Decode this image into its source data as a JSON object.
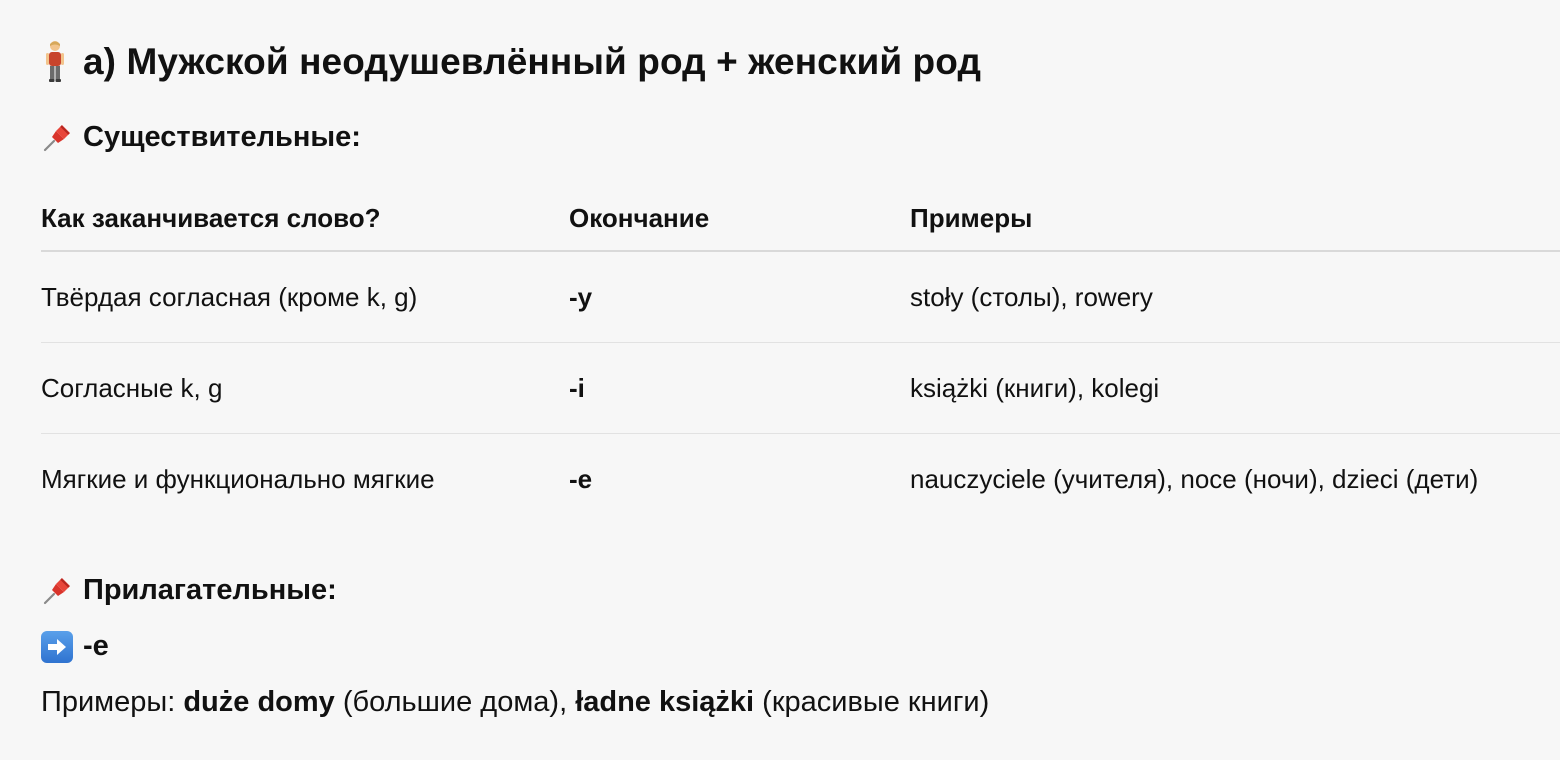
{
  "heading": {
    "icon": "person-standing-icon",
    "text": "а) Мужской неодушевлённый род + женский род"
  },
  "nouns_section": {
    "icon": "pushpin-icon",
    "title": "Существительные:"
  },
  "table": {
    "headers": [
      "Как заканчивается слово?",
      "Окончание",
      "Примеры"
    ],
    "rows": [
      [
        "Твёрдая согласная (кроме k, g)",
        "-y",
        "stoły (столы), rowery"
      ],
      [
        "Согласные k, g",
        "-i",
        "książki (книги), kolegi"
      ],
      [
        "Мягкие и функционально мягкие",
        "-e",
        "nauczyciele (учителя), noce (ночи), dzieci (дети)"
      ]
    ]
  },
  "adjectives_section": {
    "icon": "pushpin-icon",
    "title": "Прилагательные:",
    "ending_icon": "right-arrow-icon",
    "ending": "-e",
    "examples": {
      "prefix": "Примеры: ",
      "ex1_pl": "duże domy",
      "ex1_ru": " (большие дома), ",
      "ex2_pl": "ładne książki",
      "ex2_ru": " (красивые книги)"
    }
  },
  "colors": {
    "background": "#f7f7f7",
    "text": "#111111",
    "row_divider": "#e2e2e2",
    "header_divider": "#d9d9d9",
    "arrow_box": "#3b82dc"
  }
}
